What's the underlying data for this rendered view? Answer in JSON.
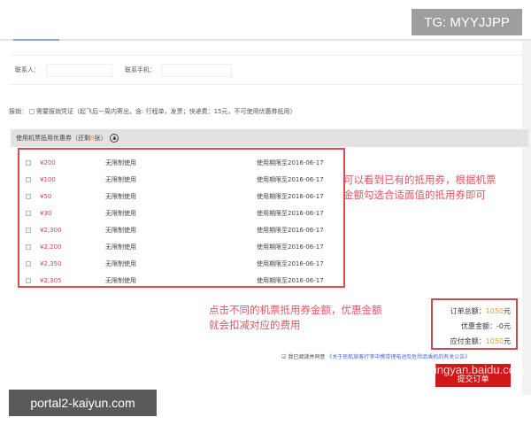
{
  "watermark_top": "TG: MYYJJPP",
  "watermark_bottom": "portal2-kaiyun.com",
  "contact": {
    "name_label": "联系人：",
    "phone_label": "联系手机："
  },
  "reimburse": {
    "label": "报销：",
    "option": "需要报销凭证（起飞后一周内寄出，含: 行程单，发票；快递费：15元，不可使用优惠券抵用）"
  },
  "coupons": {
    "header_prefix": "使用机票抵用优惠券（还剩",
    "remaining": "8",
    "header_suffix": "张）",
    "toggle_icon": "chevron-up-icon",
    "items": [
      {
        "amount": "¥200",
        "rule": "无限制使用",
        "expiry": "使用期限至2016-06-17"
      },
      {
        "amount": "¥100",
        "rule": "无限制使用",
        "expiry": "使用期限至2016-06-17"
      },
      {
        "amount": "¥50",
        "rule": "无限制使用",
        "expiry": "使用期限至2016-06-17"
      },
      {
        "amount": "¥30",
        "rule": "无限制使用",
        "expiry": "使用期限至2016-06-17"
      },
      {
        "amount": "¥2,300",
        "rule": "无限制使用",
        "expiry": "使用期限至2016-06-17"
      },
      {
        "amount": "¥2,200",
        "rule": "无限制使用",
        "expiry": "使用期限至2016-06-17"
      },
      {
        "amount": "¥2,350",
        "rule": "无限制使用",
        "expiry": "使用期限至2016-06-17"
      },
      {
        "amount": "¥2,305",
        "rule": "无限制使用",
        "expiry": "使用期限至2016-06-17"
      }
    ]
  },
  "annotations": {
    "right_line1": "可以看到已有的抵用券，根据机票",
    "right_line2": "金额勾选合适面值的抵用券即可",
    "bottom_line1": "点击不同的机票抵用券金额，优惠金额",
    "bottom_line2": "就会扣减对应的费用"
  },
  "summary": {
    "total_label": "订单总额：",
    "total_value": "1050",
    "discount_label": "优惠金额：",
    "discount_value": "-0",
    "payable_label": "应付金额：",
    "payable_value": "1050",
    "unit": "元"
  },
  "agreement": {
    "label": "我已阅读并同意",
    "link": "《关于民航旅客行李中携带锂电池及危险品乘机的有关公告》"
  },
  "baidu_watermark": "jingyan.baidu.com",
  "submit_label": "提交订单",
  "colors": {
    "accent_red": "#d01818",
    "coupon_amount": "#d8405a",
    "annotation": "#e05565",
    "highlight": "#e89a30"
  }
}
